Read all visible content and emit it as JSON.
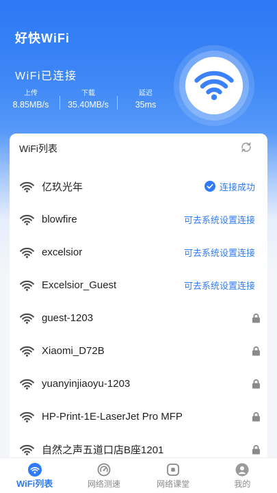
{
  "app": {
    "title": "好快WiFi"
  },
  "connection": {
    "status_text": "WiFi已连接",
    "hero_icon": "wifi-icon",
    "stats": [
      {
        "label": "上传",
        "value": "8.85MB/s"
      },
      {
        "label": "下载",
        "value": "35.40MB/s"
      },
      {
        "label": "延迟",
        "value": "35ms"
      }
    ]
  },
  "wifi_list": {
    "title": "WiFi列表",
    "refresh_icon": "refresh-icon",
    "items": [
      {
        "name": "亿玖光年",
        "signal_icon": "wifi-icon",
        "status_icon": "check-circle-icon",
        "status_text": "连接成功"
      },
      {
        "name": "blowfire",
        "signal_icon": "wifi-icon",
        "status_text": "可去系统设置连接"
      },
      {
        "name": "excelsior",
        "signal_icon": "wifi-icon",
        "status_text": "可去系统设置连接"
      },
      {
        "name": "Excelsior_Guest",
        "signal_icon": "wifi-icon",
        "status_text": "可去系统设置连接"
      },
      {
        "name": "guest-1203",
        "signal_icon": "wifi-icon",
        "status_icon": "lock-icon"
      },
      {
        "name": "Xiaomi_D72B",
        "signal_icon": "wifi-icon",
        "status_icon": "lock-icon"
      },
      {
        "name": "yuanyinjiaoyu-1203",
        "signal_icon": "wifi-icon",
        "status_icon": "lock-icon"
      },
      {
        "name": "HP-Print-1E-LaserJet Pro MFP",
        "signal_icon": "wifi-icon",
        "status_icon": "lock-icon"
      },
      {
        "name": "自然之声五道口店B座1201",
        "signal_icon": "wifi-icon",
        "status_icon": "lock-icon"
      }
    ]
  },
  "nav": {
    "tabs": [
      {
        "label": "WiFi列表",
        "icon": "wifi-icon",
        "active": true
      },
      {
        "label": "网络测速",
        "icon": "speedometer-icon",
        "active": false
      },
      {
        "label": "网络课堂",
        "icon": "classroom-icon",
        "active": false
      },
      {
        "label": "我的",
        "icon": "profile-icon",
        "active": false
      }
    ]
  },
  "colors": {
    "primary": "#2f7bf5",
    "header_blue": "#2d78f4",
    "text": "#222222",
    "muted": "#8a8a8a",
    "background": "#f3f5f9"
  }
}
